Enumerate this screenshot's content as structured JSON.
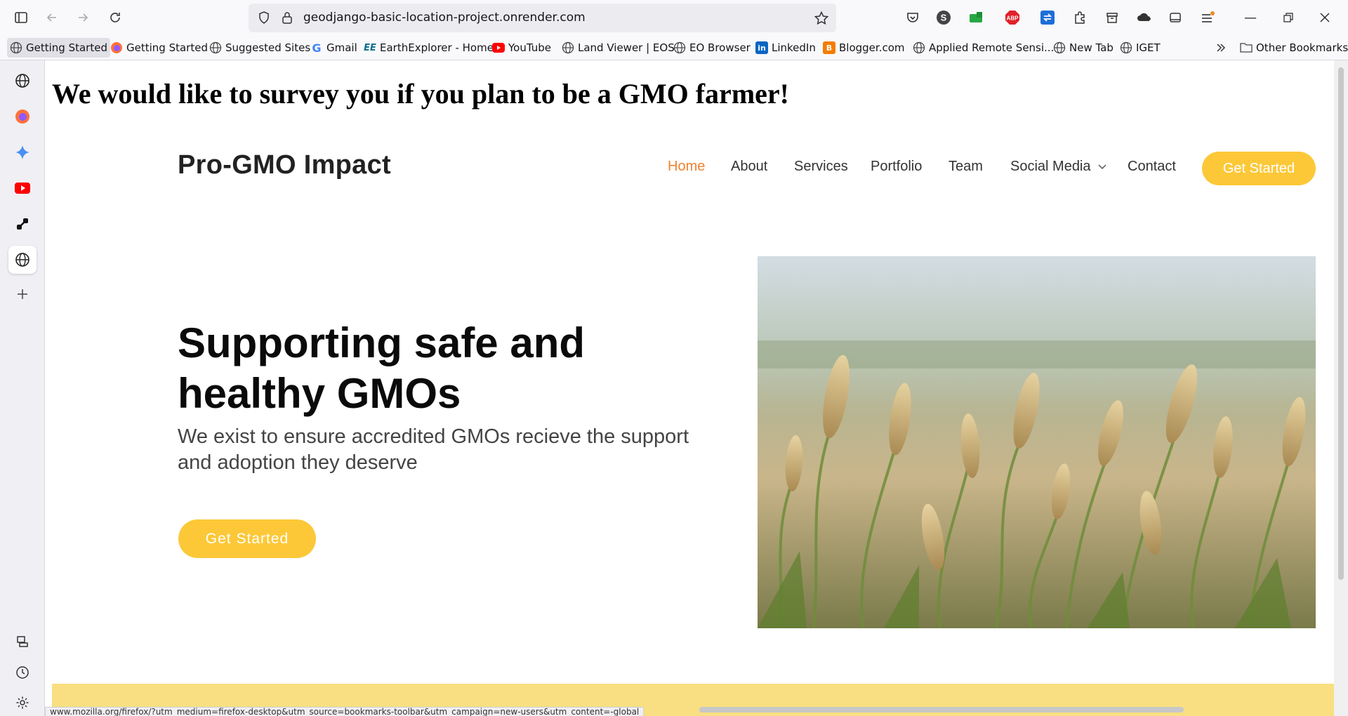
{
  "browser": {
    "url": "geodjango-basic-location-project.onrender.com",
    "status_url": "www.mozilla.org/firefox/?utm_medium=firefox-desktop&utm_source=bookmarks-toolbar&utm_campaign=new-users&utm_content=-global"
  },
  "bookmarks": [
    {
      "label": "Getting Started",
      "icon": "globe-icon"
    },
    {
      "label": "Getting Started",
      "icon": "firefox-icon"
    },
    {
      "label": "Suggested Sites",
      "icon": "globe-icon"
    },
    {
      "label": "Gmail",
      "icon": "google-icon"
    },
    {
      "label": "EarthExplorer - Home",
      "icon": "earthexplorer-icon"
    },
    {
      "label": "YouTube",
      "icon": "youtube-icon"
    },
    {
      "label": "Land Viewer | EOS",
      "icon": "globe-icon"
    },
    {
      "label": "EO Browser",
      "icon": "globe-icon"
    },
    {
      "label": "LinkedIn",
      "icon": "linkedin-icon"
    },
    {
      "label": "Blogger.com",
      "icon": "blogger-icon"
    },
    {
      "label": "Applied Remote Sensi...",
      "icon": "globe-icon"
    },
    {
      "label": "New Tab",
      "icon": "globe-icon"
    },
    {
      "label": "IGET",
      "icon": "globe-icon"
    }
  ],
  "other_bookmarks": "Other Bookmarks",
  "page": {
    "survey_banner": "We would like to survey you if you plan to be a GMO farmer!",
    "logo": "Pro-GMO Impact",
    "nav": [
      {
        "label": "Home"
      },
      {
        "label": "About"
      },
      {
        "label": "Services"
      },
      {
        "label": "Portfolio"
      },
      {
        "label": "Team"
      },
      {
        "label": "Social Media"
      },
      {
        "label": "Contact"
      }
    ],
    "nav_cta": "Get Started",
    "hero": {
      "title_line1": "Supporting safe and",
      "title_line2": "healthy GMOs",
      "subtitle_line1": "We exist to ensure accredited GMOs recieve the support",
      "subtitle_line2": "and adoption they deserve",
      "cta": "Get Started"
    }
  },
  "colors": {
    "accent_yellow": "#fcc838",
    "nav_active": "#f2822f",
    "band": "#f9df81"
  }
}
